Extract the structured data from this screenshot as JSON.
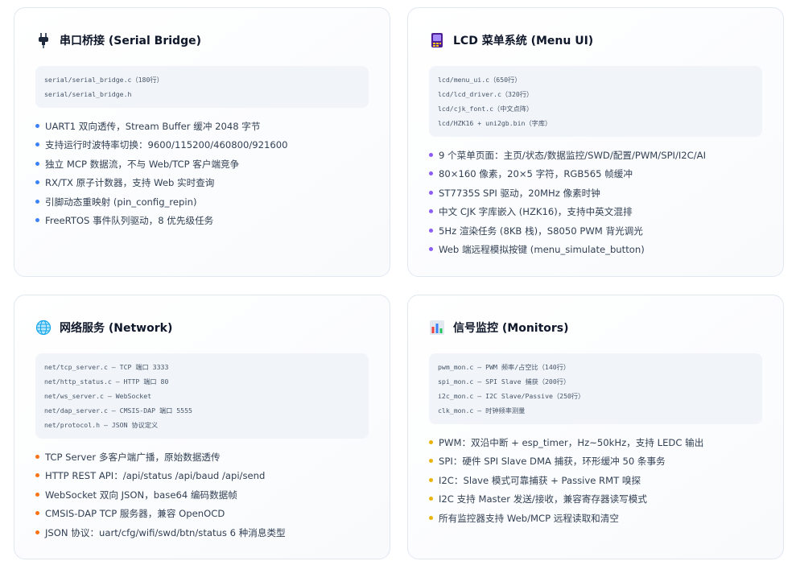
{
  "colors": {
    "serial_dot": "#3b82f6",
    "lcd_dot": "#8b5cf6",
    "network_dot": "#f97316",
    "monitor_dot": "#eab308"
  },
  "cards": {
    "serial": {
      "icon": "plug-icon",
      "title": "串口桥接 (Serial Bridge)",
      "code": [
        "serial/serial_bridge.c（180行）",
        "serial/serial_bridge.h"
      ],
      "items": [
        "UART1 双向透传，Stream Buffer 缓冲 2048 字节",
        "支持运行时波特率切换：9600/115200/460800/921600",
        "独立 MCP 数据流，不与 Web/TCP 客户端竞争",
        "RX/TX 原子计数器，支持 Web 实时查询",
        "引脚动态重映射 (pin_config_repin)",
        "FreeRTOS 事件队列驱动，8 优先级任务"
      ]
    },
    "lcd": {
      "icon": "lcd-screen-icon",
      "title": "LCD 菜单系统 (Menu UI)",
      "code": [
        "lcd/menu_ui.c（650行）",
        "lcd/lcd_driver.c（320行）",
        "lcd/cjk_font.c（中文点阵）",
        "lcd/HZK16 + uni2gb.bin（字库）"
      ],
      "items": [
        "9 个菜单页面：主页/状态/数据监控/SWD/配置/PWM/SPI/I2C/AI",
        "80×160 像素，20×5 字符，RGB565 帧缓冲",
        "ST7735S SPI 驱动，20MHz 像素时钟",
        "中文 CJK 字库嵌入 (HZK16)，支持中英文混排",
        "5Hz 渲染任务 (8KB 栈)，S8050 PWM 背光调光",
        "Web 端远程模拟按键 (menu_simulate_button)"
      ]
    },
    "network": {
      "icon": "globe-icon",
      "title": "网络服务 (Network)",
      "code": [
        "net/tcp_server.c — TCP 端口 3333",
        "net/http_status.c — HTTP 端口 80",
        "net/ws_server.c — WebSocket",
        "net/dap_server.c — CMSIS-DAP 端口 5555",
        "net/protocol.h — JSON 协议定义"
      ],
      "items": [
        "TCP Server 多客户端广播，原始数据透传",
        "HTTP REST API：/api/status /api/baud /api/send",
        "WebSocket 双向 JSON，base64 编码数据帧",
        "CMSIS-DAP TCP 服务器，兼容 OpenOCD",
        "JSON 协议：uart/cfg/wifi/swd/btn/status 6 种消息类型"
      ]
    },
    "monitor": {
      "icon": "bar-chart-icon",
      "title": "信号监控 (Monitors)",
      "code": [
        "pwm_mon.c — PWM 频率/占空比（140行）",
        "spi_mon.c — SPI Slave 捕获（200行）",
        "i2c_mon.c — I2C Slave/Passive（250行）",
        "clk_mon.c — 时钟频率测量"
      ],
      "items": [
        "PWM：双沿中断 + esp_timer，Hz~50kHz，支持 LEDC 输出",
        "SPI：硬件 SPI Slave DMA 捕获，环形缓冲 50 条事务",
        "I2C：Slave 模式可靠捕获 + Passive RMT 嗅探",
        "I2C 支持 Master 发送/接收，兼容寄存器读写模式",
        "所有监控器支持 Web/MCP 远程读取和清空"
      ]
    }
  }
}
